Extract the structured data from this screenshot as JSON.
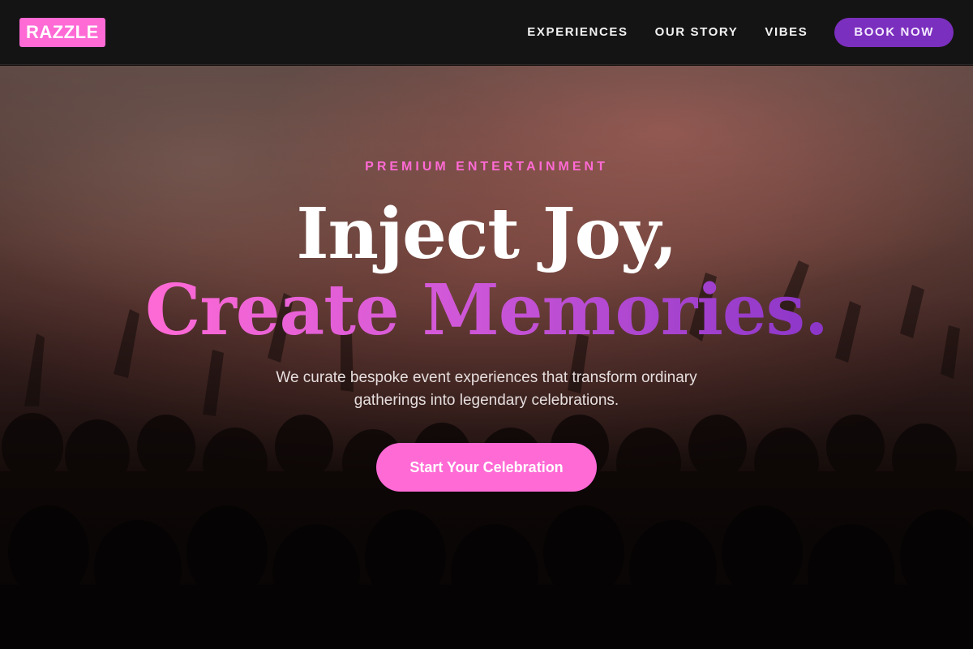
{
  "brand": {
    "logo_text": "RAZZLE",
    "accent": "#ff6ad5",
    "purple": "#7b2fbe"
  },
  "nav": {
    "links": [
      "EXPERIENCES",
      "OUR STORY",
      "VIBES"
    ],
    "cta_label": "BOOK NOW"
  },
  "hero": {
    "eyebrow": "PREMIUM ENTERTAINMENT",
    "headline_line1": "Inject Joy,",
    "headline_line2": "Create Memories.",
    "subtext": "We curate bespoke event experiences that transform ordinary gatherings into legendary celebrations.",
    "cta_label": "Start Your Celebration",
    "background_image": "concert-crowd-photo"
  }
}
